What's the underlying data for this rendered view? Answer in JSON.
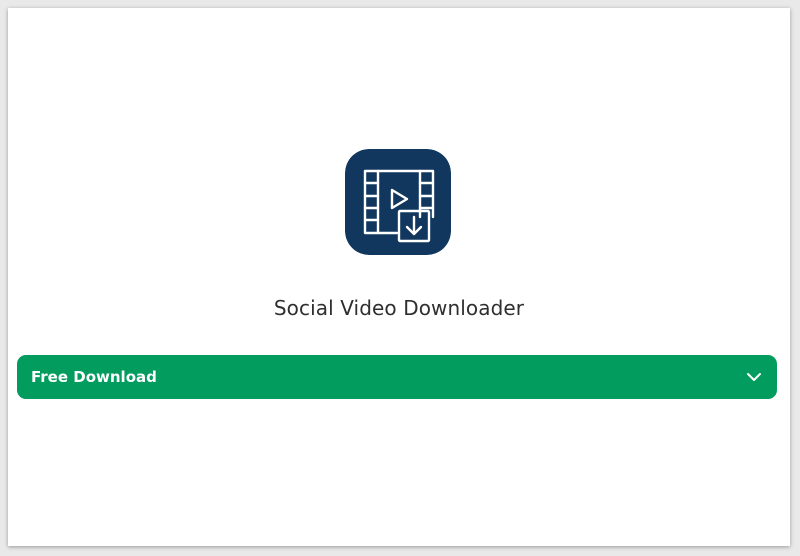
{
  "app": {
    "name": "Social Video Downloader",
    "icon": "film-download-icon",
    "icon_bg": "#11375e"
  },
  "download": {
    "label": "Free Download",
    "bg_color": "#019c5e",
    "dropdown_icon": "chevron-down-icon"
  }
}
